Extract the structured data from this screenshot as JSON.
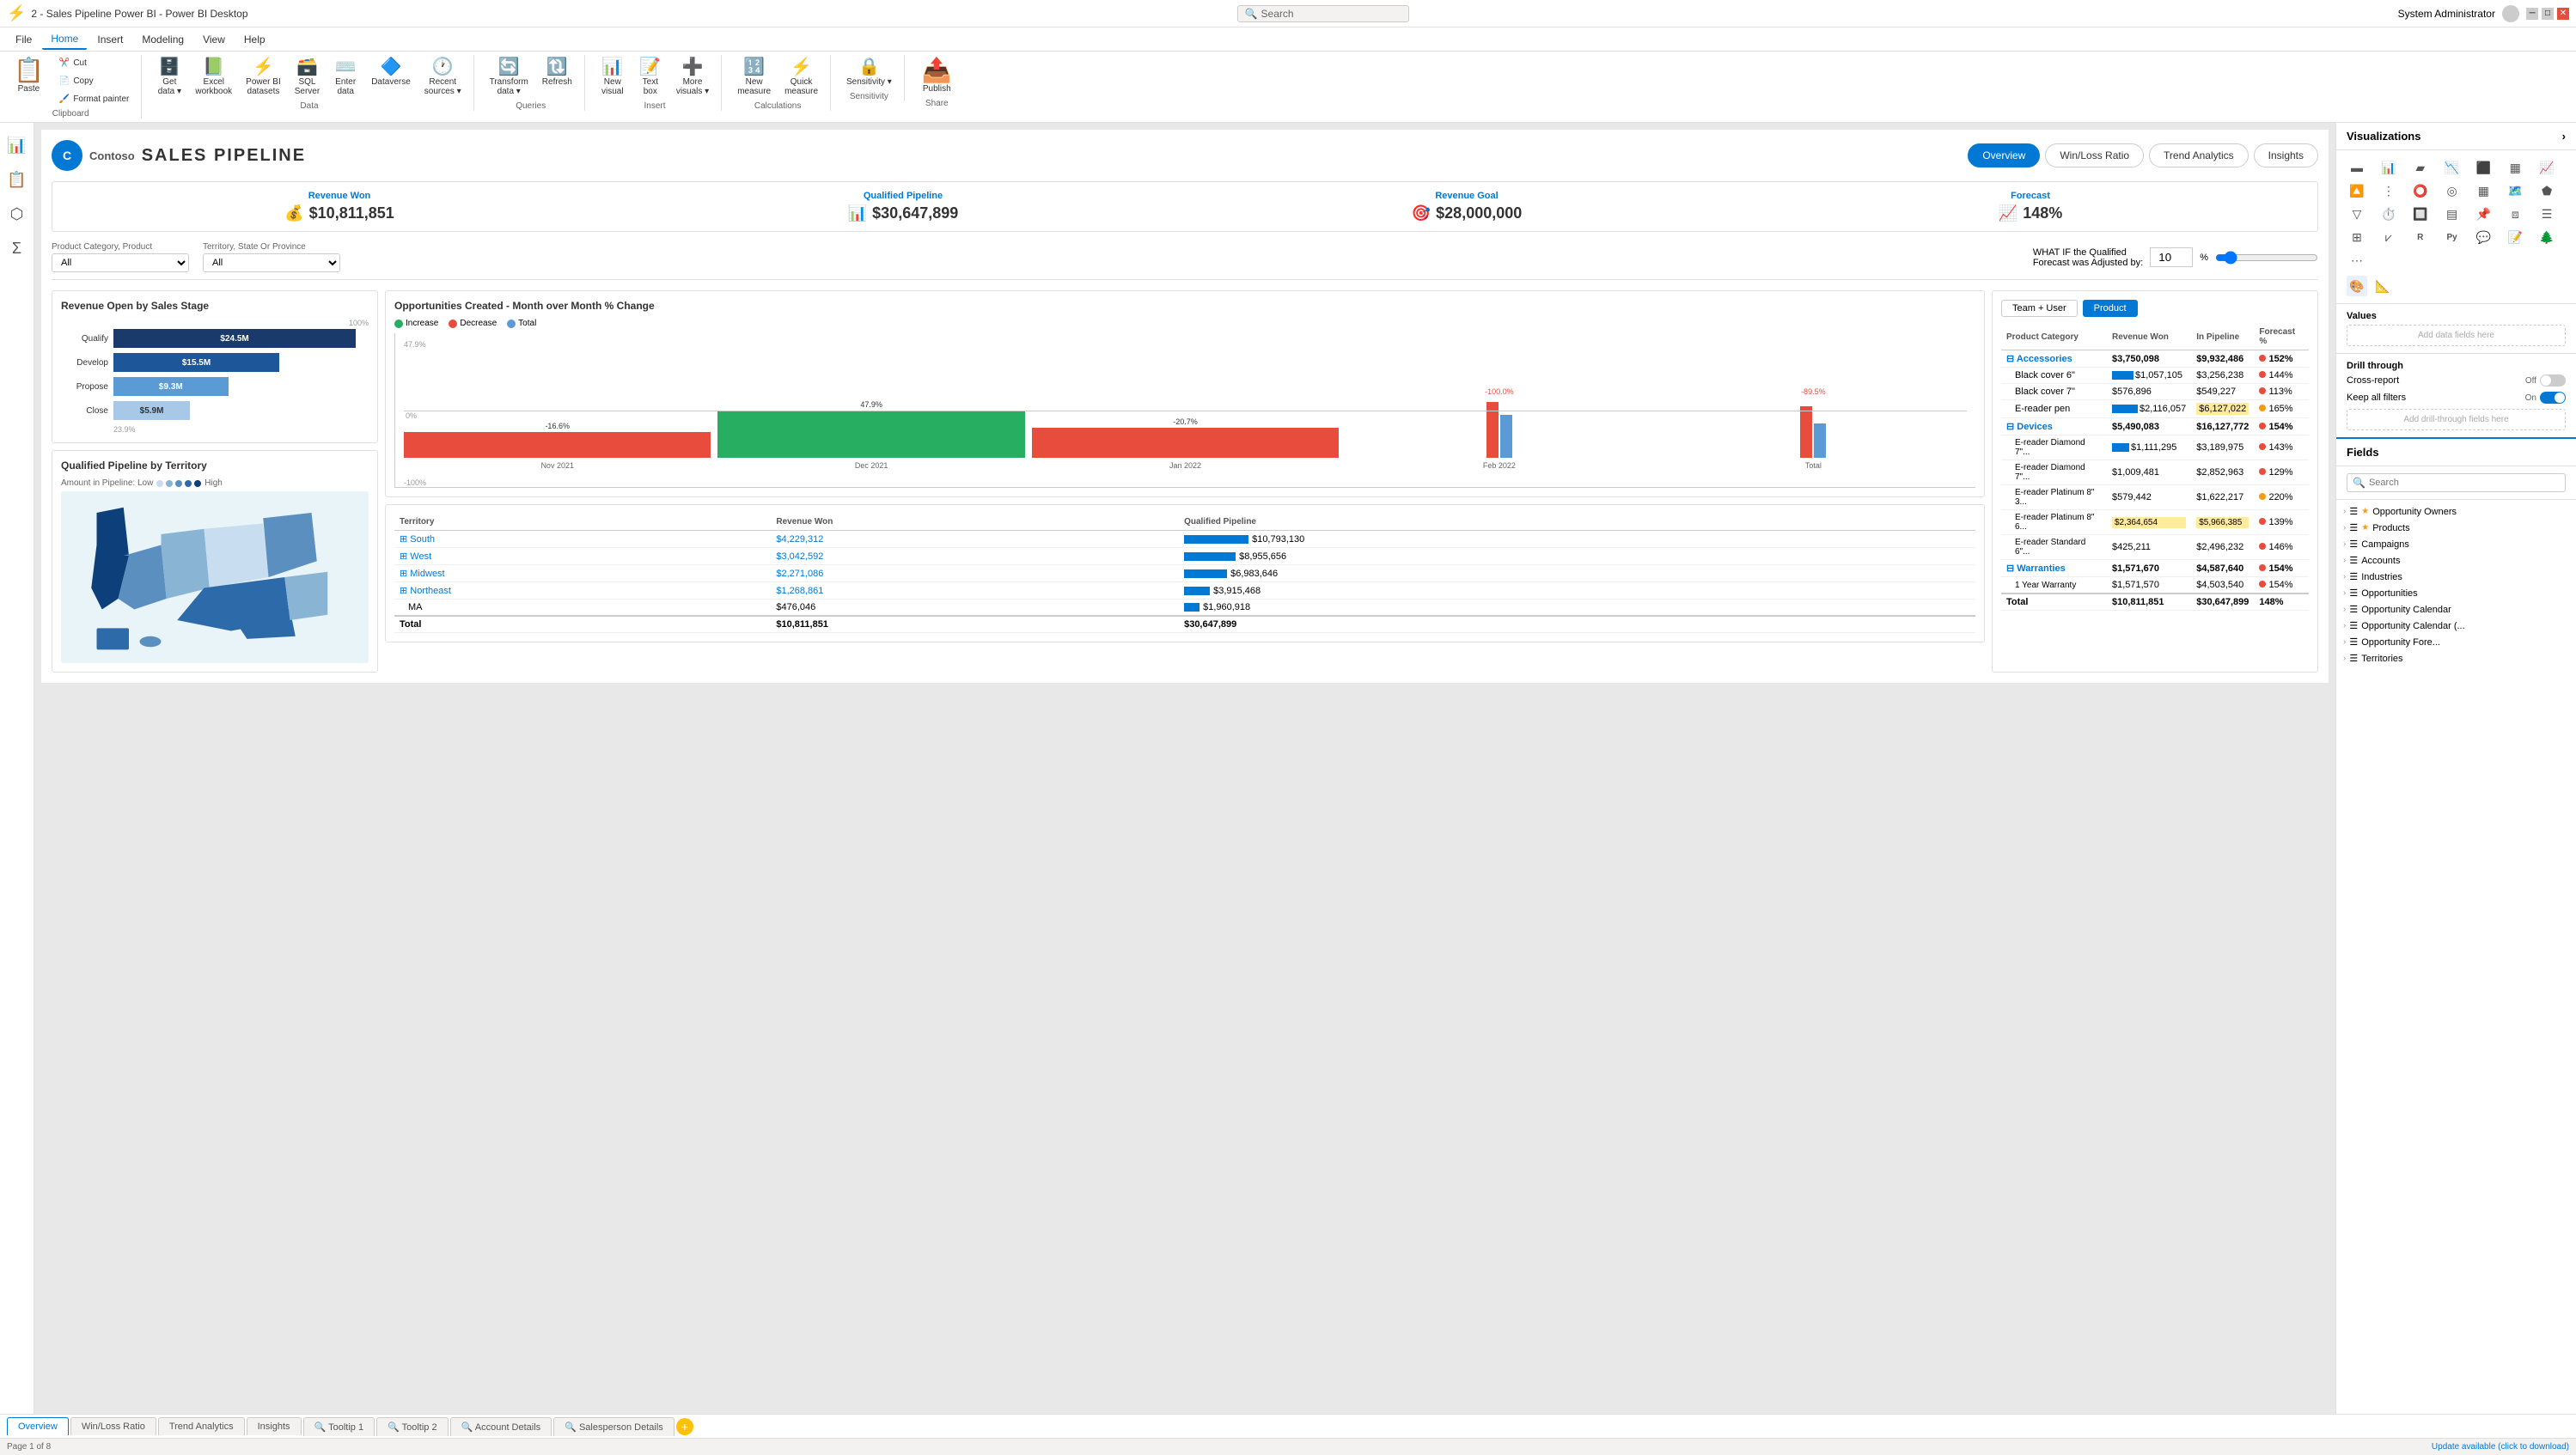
{
  "titleBar": {
    "title": "2 - Sales Pipeline Power BI - Power BI Desktop",
    "searchPlaceholder": "Search",
    "user": "System Administrator"
  },
  "menu": {
    "items": [
      "File",
      "Home",
      "Insert",
      "Modeling",
      "View",
      "Help"
    ]
  },
  "ribbon": {
    "clipboard": {
      "label": "Clipboard",
      "buttons": [
        "Paste",
        "Cut",
        "Copy",
        "Format painter"
      ]
    },
    "data": {
      "label": "Data",
      "buttons": [
        "Get data",
        "Excel workbook",
        "Power BI datasets",
        "SQL Server",
        "Enter data",
        "Dataverse",
        "Recent sources"
      ]
    },
    "queries": {
      "label": "Queries",
      "buttons": [
        "Transform data",
        "Refresh"
      ]
    },
    "insert": {
      "label": "Insert",
      "buttons": [
        "New visual",
        "Text box",
        "More visuals"
      ]
    },
    "calculations": {
      "label": "Calculations",
      "buttons": [
        "New measure",
        "Quick measure"
      ]
    },
    "sensitivity": {
      "label": "Sensitivity",
      "buttons": [
        "Sensitivity"
      ]
    },
    "share": {
      "label": "Share",
      "buttons": [
        "Publish"
      ]
    }
  },
  "report": {
    "logoText": "C",
    "company": "Contoso",
    "title": "SALES PIPELINE",
    "navButtons": [
      "Overview",
      "Win/Loss Ratio",
      "Trend Analytics",
      "Insights"
    ],
    "activeNav": "Overview"
  },
  "kpis": [
    {
      "label": "Revenue Won",
      "value": "$10,811,851",
      "icon": "💰"
    },
    {
      "label": "Qualified Pipeline",
      "value": "$30,647,899",
      "icon": "📊"
    },
    {
      "label": "Revenue Goal",
      "value": "$28,000,000",
      "icon": "🎯"
    },
    {
      "label": "Forecast",
      "value": "148%",
      "icon": "📈"
    }
  ],
  "filters": {
    "productFilter": {
      "label": "Product Category, Product",
      "value": "All"
    },
    "territoryFilter": {
      "label": "Territory, State Or Province",
      "value": "All"
    },
    "whatIf": {
      "label": "WHAT IF the Qualified Forecast was Adjusted by:",
      "value": "10",
      "unit": "%"
    }
  },
  "revenueChart": {
    "title": "Revenue Open by Sales Stage",
    "pctLabel": "100%",
    "bottomLabel": "23.9%",
    "bars": [
      {
        "label": "Qualify",
        "value": "$24.5M",
        "width": 95
      },
      {
        "label": "Develop",
        "value": "$15.5M",
        "width": 65
      },
      {
        "label": "Propose",
        "value": "$9.3M",
        "width": 45
      },
      {
        "label": "Close",
        "value": "$5.9M",
        "width": 30
      }
    ]
  },
  "opportunitiesChart": {
    "title": "Opportunities Created - Month over Month % Change",
    "legend": [
      "Increase",
      "Decrease",
      "Total"
    ],
    "months": [
      "Nov 2021",
      "Dec 2021",
      "Jan 2022",
      "Feb 2022",
      "Total"
    ],
    "values": [
      "47.9%",
      "-16.6%",
      "-20.7%",
      "-100.0%",
      "-89.5%"
    ]
  },
  "mapChart": {
    "title": "Qualified Pipeline by Territory",
    "subtitle": "Amount in Pipeline: Low",
    "legendLabels": "High"
  },
  "territoryTable": {
    "title": "",
    "columns": [
      "Territory",
      "Revenue Won",
      "Qualified Pipeline"
    ],
    "rows": [
      {
        "territory": "South",
        "revenueWon": "$4,229,312",
        "qualifiedPipeline": "$10,793,130",
        "barWidth": 80
      },
      {
        "territory": "West",
        "revenueWon": "$3,042,592",
        "qualifiedPipeline": "$8,955,656",
        "barWidth": 65
      },
      {
        "territory": "Midwest",
        "revenueWon": "$2,271,086",
        "qualifiedPipeline": "$6,983,646",
        "barWidth": 55
      },
      {
        "territory": "Northeast",
        "revenueWon": "$1,268,861",
        "qualifiedPipeline": "$3,915,468",
        "barWidth": 35
      },
      {
        "territory": "MA",
        "revenueWon": "$476,046",
        "qualifiedPipeline": "$1,960,918",
        "barWidth": 20
      }
    ],
    "total": {
      "label": "Total",
      "revenueWon": "$10,811,851",
      "qualifiedPipeline": "$30,647,899"
    }
  },
  "productTable": {
    "toggle": [
      "Team + User",
      "Product"
    ],
    "activeToggle": "Product",
    "columns": [
      "Product Category",
      "Revenue Won",
      "In Pipeline",
      "Forecast %"
    ],
    "rows": [
      {
        "category": "Accessories",
        "revenueWon": "$3,750,098",
        "inPipeline": "$9,932,486",
        "forecast": "152%",
        "dotColor": "red",
        "expanded": true
      },
      {
        "subcategory": "Black cover 6\"",
        "revenueWon": "$1,057,105",
        "inPipeline": "$3,256,238",
        "forecast": "144%",
        "dotColor": "red"
      },
      {
        "subcategory": "Black cover 7\"",
        "revenueWon": "$576,896",
        "inPipeline": "$549,227",
        "forecast": "113%",
        "dotColor": "red"
      },
      {
        "subcategory": "E-reader pen",
        "revenueWon": "$2,116,057",
        "inPipeline": "$6,127,022",
        "forecast": "165%",
        "dotColor": "orange"
      },
      {
        "category": "Devices",
        "revenueWon": "$5,490,083",
        "inPipeline": "$16,127,772",
        "forecast": "154%",
        "dotColor": "red",
        "expanded": true
      },
      {
        "subcategory": "E-reader Diamond 7\"...",
        "revenueWon": "$1,111,295",
        "inPipeline": "$3,189,975",
        "forecast": "143%",
        "dotColor": "red"
      },
      {
        "subcategory": "E-reader Diamond 7\"...",
        "revenueWon": "$1,009,481",
        "inPipeline": "$2,852,963",
        "forecast": "129%",
        "dotColor": "red"
      },
      {
        "subcategory": "E-reader Platinum 8\" 3...",
        "revenueWon": "$579,442",
        "inPipeline": "$1,622,217",
        "forecast": "220%",
        "dotColor": "orange"
      },
      {
        "subcategory": "E-reader Platinum 8\" 6...",
        "revenueWon": "$2,364,654",
        "inPipeline": "$5,966,385",
        "forecast": "139%",
        "dotColor": "red"
      },
      {
        "subcategory": "E-reader Standard 6\"...",
        "revenueWon": "$425,211",
        "inPipeline": "$2,496,232",
        "forecast": "146%",
        "dotColor": "red"
      },
      {
        "category": "Warranties",
        "revenueWon": "$1,571,670",
        "inPipeline": "$4,587,640",
        "forecast": "154%",
        "dotColor": "red",
        "expanded": false
      },
      {
        "subcategory": "1 Year Warranty",
        "revenueWon": "$1,571,570",
        "inPipeline": "$4,503,540",
        "forecast": "154%",
        "dotColor": "red"
      }
    ],
    "total": {
      "label": "Total",
      "revenueWon": "$10,811,851",
      "inPipeline": "$30,647,899",
      "forecast": "148%"
    }
  },
  "visualizations": {
    "panelTitle": "Visualizations",
    "vizIcons": [
      "📊",
      "📈",
      "🔢",
      "📉",
      "🥧",
      "🗺️",
      "🌡️",
      "📋",
      "📐",
      "🔲",
      "⬜",
      "🔳",
      "📍",
      "💹",
      "🔑",
      "⚙️",
      "📌",
      "🔗",
      "📎",
      "🔧",
      "⬛"
    ],
    "valuesTitle": "Values",
    "valuesPlaceholder": "Add data fields here",
    "drillthrough": {
      "title": "Drill through",
      "crossReport": "Cross-report",
      "off": "Off",
      "keepFilters": "Keep all filters",
      "on": "On",
      "addPlaceholder": "Add drill-through fields here"
    }
  },
  "fields": {
    "panelTitle": "Fields",
    "searchPlaceholder": "Search",
    "items": [
      {
        "label": "Opportunity Owners",
        "icon": "📋",
        "type": "table"
      },
      {
        "label": "Products",
        "icon": "⭐",
        "type": "table"
      },
      {
        "label": "Campaigns",
        "icon": "📋",
        "type": "table"
      },
      {
        "label": "Accounts",
        "icon": "📋",
        "type": "table"
      },
      {
        "label": "Industries",
        "icon": "📋",
        "type": "table"
      },
      {
        "label": "Opportunities",
        "icon": "📋",
        "type": "table"
      },
      {
        "label": "Opportunity Calendar",
        "icon": "📋",
        "type": "table"
      },
      {
        "label": "Opportunity Calendar (...",
        "icon": "📋",
        "type": "table"
      },
      {
        "label": "Opportunity Fore...",
        "icon": "📋",
        "type": "table"
      },
      {
        "label": "Territories",
        "icon": "📋",
        "type": "table"
      }
    ]
  },
  "pageTabs": [
    {
      "label": "Overview",
      "active": true
    },
    {
      "label": "Win/Loss Ratio",
      "active": false
    },
    {
      "label": "Trend Analytics",
      "active": false
    },
    {
      "label": "Insights",
      "active": false
    },
    {
      "label": "Tooltip 1",
      "active": false,
      "icon": "🔍"
    },
    {
      "label": "Tooltip 2",
      "active": false,
      "icon": "🔍"
    },
    {
      "label": "Account Details",
      "active": false,
      "icon": "🔍"
    },
    {
      "label": "Salesperson Details",
      "active": false,
      "icon": "🔍"
    }
  ],
  "statusBar": {
    "pageInfo": "Page 1 of 8",
    "updateMessage": "Update available (click to download)"
  }
}
